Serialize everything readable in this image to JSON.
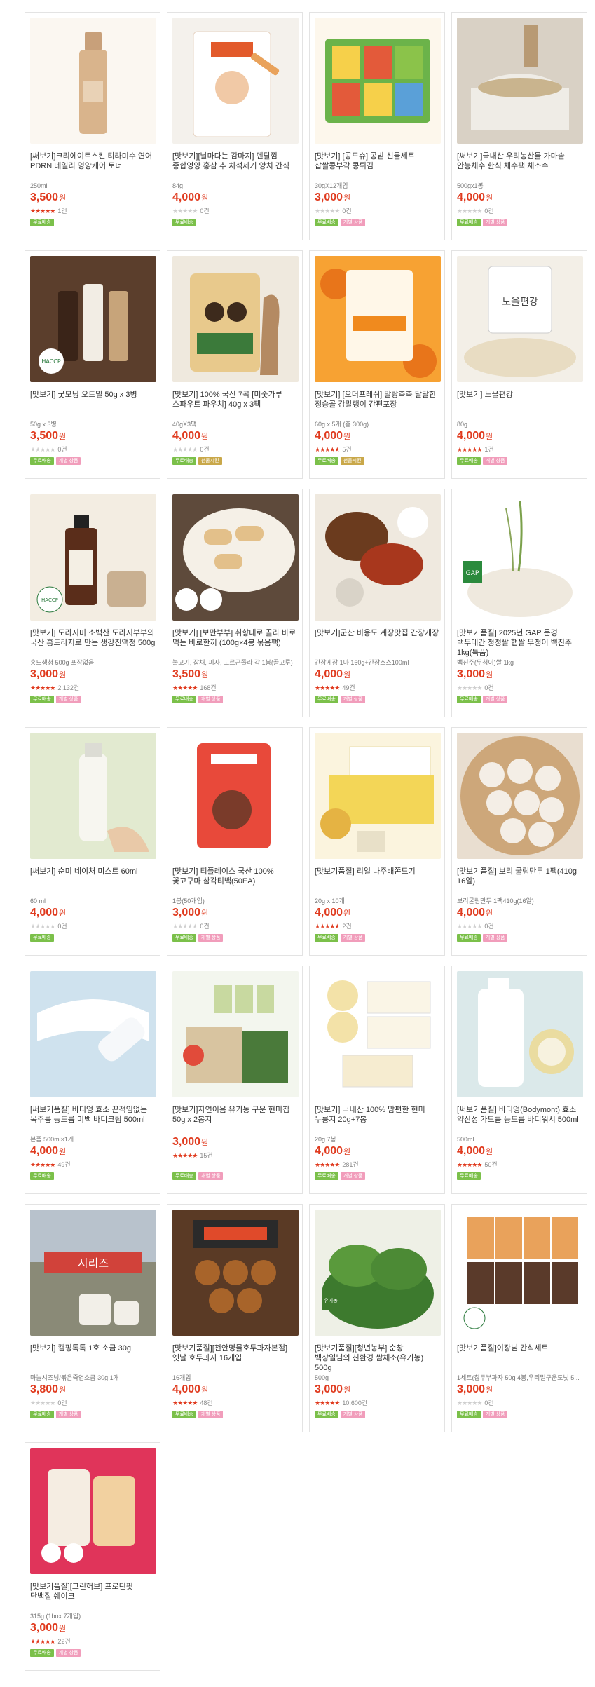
{
  "colors": {
    "price": "#e03b1f",
    "star_on": "#e03b1f",
    "star_off": "#cfcfcf",
    "badge_free_ship": "#7bc04a",
    "badge_unit": "#f19dbb",
    "badge_gift": "#c9a84a"
  },
  "products": [
    {
      "name": "[써보기]크리에이트스킨 티라미수 연어 PDRN 데일리 영양케어 토너",
      "option": "250ml",
      "price": "3,500",
      "currency": "원",
      "stars": 5,
      "review_count": "1건",
      "badges": [
        {
          "label": "무료배송",
          "type": "free_ship"
        }
      ],
      "image": "toner-bottle-image"
    },
    {
      "name": "[맛보기][날마다는 감마지] 덴탈껌 종합영양 홍삼 추 치석제거 양치 간식",
      "option": "84g",
      "price": "4,000",
      "currency": "원",
      "stars": 0,
      "review_count": "0건",
      "badges": [
        {
          "label": "무료배송",
          "type": "free_ship"
        }
      ],
      "image": "pet-dental-chew-image"
    },
    {
      "name": "[맛보기] [콩드슈] 콩밭 선물세트 찹쌀콩부각 콩튀김",
      "option": "30gX12개입",
      "price": "3,000",
      "currency": "원",
      "stars": 0,
      "review_count": "0건",
      "badges": [
        {
          "label": "무료배송",
          "type": "free_ship"
        },
        {
          "label": "개별 상품",
          "type": "unit"
        }
      ],
      "image": "snack-gift-set-image"
    },
    {
      "name": "[써보기]국내산 우리농산물 가마솥 안능채수 한식 채수팩 채소수",
      "option": "500gx1봉",
      "price": "4,000",
      "currency": "원",
      "stars": 0,
      "review_count": "0건",
      "badges": [
        {
          "label": "무료배송",
          "type": "free_ship"
        },
        {
          "label": "개별 상품",
          "type": "unit"
        }
      ],
      "image": "broth-pot-image"
    },
    {
      "name": "[맛보기] 굿모닝 오트밀 50g x 3병",
      "option": "50g x 3병",
      "price": "3,500",
      "currency": "원",
      "stars": 0,
      "review_count": "0건",
      "badges": [
        {
          "label": "무료배송",
          "type": "free_ship"
        },
        {
          "label": "개별 상품",
          "type": "unit"
        }
      ],
      "image": "oatmeal-bottles-image"
    },
    {
      "name": "[맛보기] 100% 국산 7곡 [미숫가루 스파우트 파우치] 40g x 3팩",
      "option": "40gX3팩",
      "price": "4,000",
      "currency": "원",
      "stars": 0,
      "review_count": "0건",
      "badges": [
        {
          "label": "무료배송",
          "type": "free_ship"
        },
        {
          "label": "선물시킨",
          "type": "gift"
        }
      ],
      "image": "misutgaru-pouch-image"
    },
    {
      "name": "[맛보기] [오더프레쉬] 말랑촉촉 달달한 정승골 감말랭이 간편포장",
      "option": "60g x 5개 (총 300g)",
      "price": "4,000",
      "currency": "원",
      "stars": 5,
      "review_count": "5건",
      "badges": [
        {
          "label": "무료배송",
          "type": "free_ship"
        },
        {
          "label": "선물시킨",
          "type": "gift"
        }
      ],
      "image": "dried-persimmon-image"
    },
    {
      "name": "[맛보기] 노을편강",
      "option": "80g",
      "price": "4,000",
      "currency": "원",
      "stars": 5,
      "review_count": "1건",
      "badges": [
        {
          "label": "무료배송",
          "type": "free_ship"
        },
        {
          "label": "개별 상품",
          "type": "unit"
        }
      ],
      "image": "ginger-candy-image"
    },
    {
      "name": "[맛보기] 도라지미 소백산 도라지부부의 국산 홍도라지로 만든 생강진액청 500g",
      "option": "홍도생청 500g 포장없음",
      "price": "3,000",
      "currency": "원",
      "stars": 5,
      "review_count": "2,132건",
      "badges": [
        {
          "label": "무료배송",
          "type": "free_ship"
        },
        {
          "label": "개별 상품",
          "type": "unit"
        }
      ],
      "image": "ginger-syrup-image"
    },
    {
      "name": "[맛보기] [보만부부] 취향대로 골라 바로 먹는 바로한끼 (100g×4봉 묶음팩)",
      "option": "불고기, 잡채, 피자, 고르곤졸라 각 1봉(골고루)",
      "price": "3,500",
      "currency": "원",
      "stars": 5,
      "review_count": "168건",
      "badges": [
        {
          "label": "무료배송",
          "type": "free_ship"
        },
        {
          "label": "개별 상품",
          "type": "unit"
        }
      ],
      "image": "dumpling-plate-image"
    },
    {
      "name": "[맛보기]군산 비응도 계장맛집 간장게장",
      "option": "간장게장 1마 160g+간장소스100ml",
      "price": "4,000",
      "currency": "원",
      "stars": 5,
      "review_count": "49건",
      "badges": [
        {
          "label": "무료배송",
          "type": "free_ship"
        },
        {
          "label": "개별 상품",
          "type": "unit"
        }
      ],
      "image": "soy-crab-image"
    },
    {
      "name": "[맛보기품질] 2025년 GAP 문경 백두대간 청정쌀 햅쌀 무청이 백진주 1kg(특품)",
      "option": "백진주(무청이)쌀 1kg",
      "price": "3,000",
      "currency": "원",
      "stars": 0,
      "review_count": "0건",
      "badges": [
        {
          "label": "무료배송",
          "type": "free_ship"
        },
        {
          "label": "개별 상품",
          "type": "unit"
        }
      ],
      "image": "rice-grain-image"
    },
    {
      "name": "[써보기] 순미 네이처 미스트 60ml",
      "option": "60 ml",
      "price": "4,000",
      "currency": "원",
      "stars": 0,
      "review_count": "0건",
      "badges": [
        {
          "label": "무료배송",
          "type": "free_ship"
        }
      ],
      "image": "mist-spray-image"
    },
    {
      "name": "[맛보기] 티플레이스 국산 100% 꽃고구마 삼각티백(50EA)",
      "option": "1봉(50개입)",
      "price": "3,000",
      "currency": "원",
      "stars": 0,
      "review_count": "0건",
      "badges": [
        {
          "label": "무료배송",
          "type": "free_ship"
        },
        {
          "label": "개별 상품",
          "type": "unit"
        }
      ],
      "image": "tea-bag-pouch-image"
    },
    {
      "name": "[맛보기품질] 리얼 나주배쫀드기",
      "option": "20g x 10개",
      "price": "4,000",
      "currency": "원",
      "stars": 5,
      "review_count": "2건",
      "badges": [
        {
          "label": "무료배송",
          "type": "free_ship"
        },
        {
          "label": "개별 상품",
          "type": "unit"
        }
      ],
      "image": "pear-snack-box-image"
    },
    {
      "name": "[맛보기품질] 보리 굴림만두 1팩(410g 16알)",
      "option": "보리굴림만두 1팩410g(16알)",
      "price": "4,000",
      "currency": "원",
      "stars": 0,
      "review_count": "0건",
      "badges": [
        {
          "label": "무료배송",
          "type": "free_ship"
        },
        {
          "label": "개별 상품",
          "type": "unit"
        }
      ],
      "image": "steamed-dumplings-image"
    },
    {
      "name": "[써보기품질] 바디엉 효소 끈적임없는 목주름 등드름 미백 바디크림 500ml",
      "option": "본품 500ml×1개",
      "price": "4,000",
      "currency": "원",
      "stars": 5,
      "review_count": "49건",
      "badges": [
        {
          "label": "무료배송",
          "type": "free_ship"
        }
      ],
      "image": "body-cream-image"
    },
    {
      "name": "[맛보기]자연이음 유기농 구운 현미칩 50g x 2봉지",
      "option": "",
      "price": "3,000",
      "currency": "원",
      "stars": 5,
      "review_count": "15건",
      "badges": [
        {
          "label": "무료배송",
          "type": "free_ship"
        },
        {
          "label": "개별 상품",
          "type": "unit"
        }
      ],
      "image": "rice-chip-box-image"
    },
    {
      "name": "[맛보기] 국내산 100% 맘편한 현미 누룽지 20g+7봉",
      "option": "20g 7봉",
      "price": "4,000",
      "currency": "원",
      "stars": 5,
      "review_count": "281건",
      "badges": [
        {
          "label": "무료배송",
          "type": "free_ship"
        },
        {
          "label": "개별 상품",
          "type": "unit"
        }
      ],
      "image": "nurungji-pack-image"
    },
    {
      "name": "[써보기품질] 바디엉(Bodymont) 효소 약산성 가드름 등드름 바디워시 500ml",
      "option": "500ml",
      "price": "4,000",
      "currency": "원",
      "stars": 5,
      "review_count": "50건",
      "badges": [
        {
          "label": "무료배송",
          "type": "free_ship"
        }
      ],
      "image": "body-wash-image"
    },
    {
      "name": "[맛보기] 캠핑톡톡 1호 소금 30g",
      "option": "마늘시즈닝/볶은죽염소금 30g 1개",
      "price": "3,800",
      "currency": "원",
      "stars": 0,
      "review_count": "0건",
      "badges": [
        {
          "label": "무료배송",
          "type": "free_ship"
        },
        {
          "label": "개별 상품",
          "type": "unit"
        }
      ],
      "image": "camping-salt-image"
    },
    {
      "name": "[맛보기품질][천안명물호두과자본점] 옛날 호두과자 16개입",
      "option": "16개입",
      "price": "4,000",
      "currency": "원",
      "stars": 5,
      "review_count": "48건",
      "badges": [
        {
          "label": "무료배송",
          "type": "free_ship"
        },
        {
          "label": "개별 상품",
          "type": "unit"
        }
      ],
      "image": "walnut-cake-image"
    },
    {
      "name": "[맛보기품질][청년농부] 순창 백상일님의 친환경 쌈채소(유기농) 500g",
      "option": "500g",
      "price": "3,000",
      "currency": "원",
      "stars": 5,
      "review_count": "10,600건",
      "badges": [
        {
          "label": "무료배송",
          "type": "free_ship"
        },
        {
          "label": "개별 상품",
          "type": "unit"
        }
      ],
      "image": "leafy-greens-image"
    },
    {
      "name": "[맛보기품질]이장님 간식세트",
      "option": "1세트(찹두부과자 50g 4봉,우리밀구운도넛 5...",
      "price": "3,000",
      "currency": "원",
      "stars": 0,
      "review_count": "0건",
      "badges": [
        {
          "label": "무료배송",
          "type": "free_ship"
        },
        {
          "label": "개별 상품",
          "type": "unit"
        }
      ],
      "image": "snack-bags-image"
    },
    {
      "name": "[맛보기품질][그린허브] 프로틴핏 단백질 쉐이크",
      "option": "315g (1box 7개입)",
      "price": "3,000",
      "currency": "원",
      "stars": 5,
      "review_count": "22건",
      "badges": [
        {
          "label": "무료배송",
          "type": "free_ship"
        },
        {
          "label": "개별 상품",
          "type": "unit"
        }
      ],
      "image": "protein-shake-image"
    }
  ]
}
